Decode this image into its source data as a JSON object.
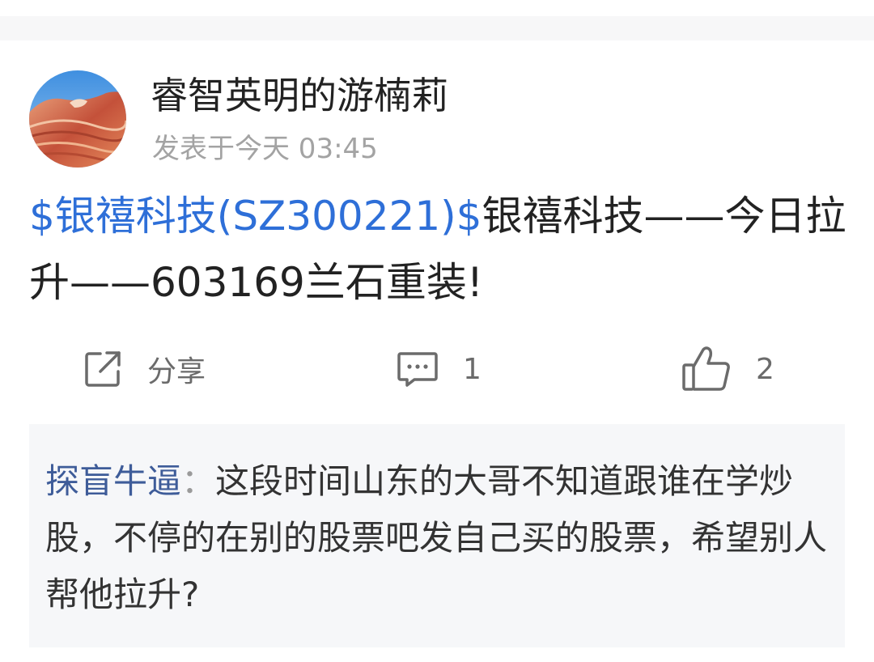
{
  "post": {
    "author": "睿智英明的游楠莉",
    "time": "发表于今天 03:45",
    "stock_tag": "$银禧科技(SZ300221)$",
    "content": "银禧科技——今日拉升——603169兰石重装!"
  },
  "actions": {
    "share_label": "分享",
    "comment_count": "1",
    "like_count": "2"
  },
  "comment": {
    "author": "探盲牛逼",
    "separator": "：",
    "text": "这段时间山东的大哥不知道跟谁在学炒股，不停的在别的股票吧发自己买的股票，希望别人帮他拉升?"
  },
  "icons": [
    "share-icon",
    "comment-icon",
    "thumbs-up-icon"
  ],
  "colors": {
    "link": "#2e6fd8",
    "commenter": "#3e5c99",
    "comment_bg": "#f6f7f9",
    "meta": "#a3a3a3"
  }
}
